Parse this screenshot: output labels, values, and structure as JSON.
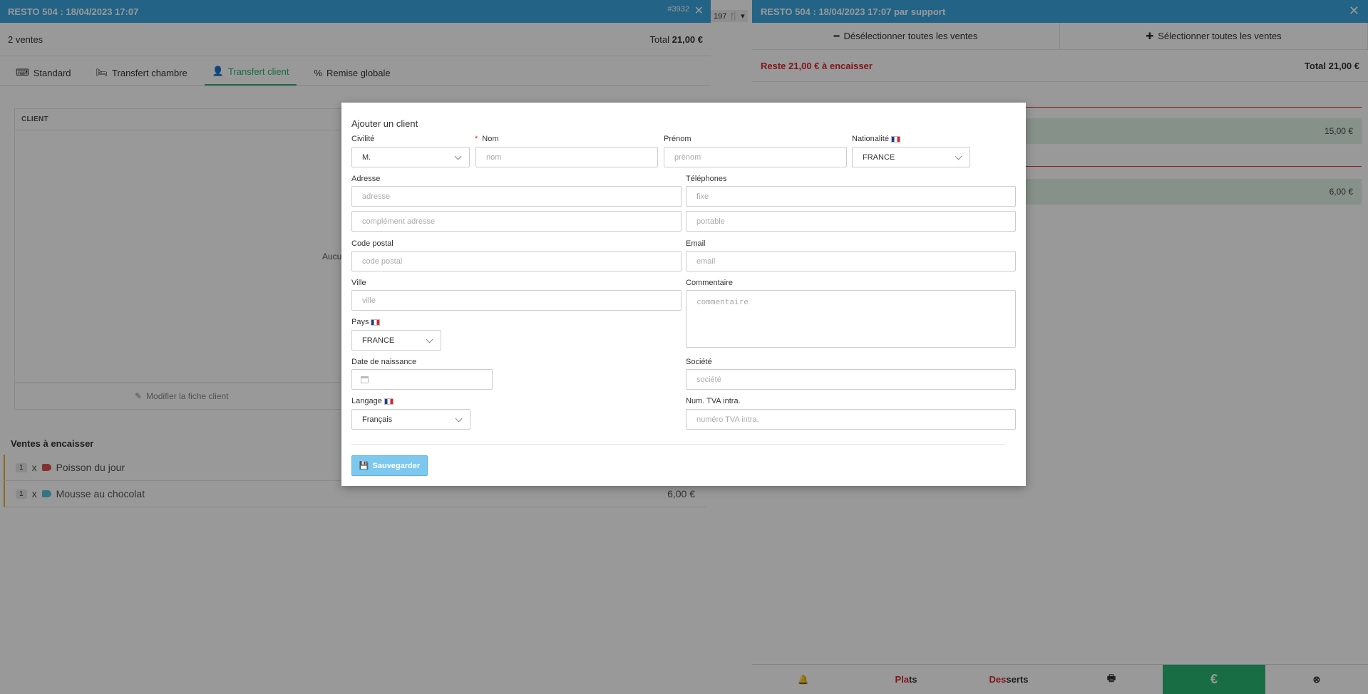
{
  "left": {
    "header_title": "RESTO 504 : 18/04/2023 17:07",
    "header_number": "#3932",
    "sales_count": "2 ventes",
    "total_label": "Total",
    "total_value": "21,00 €",
    "tabs": [
      {
        "label": "Standard",
        "icon": "keyboard-icon"
      },
      {
        "label": "Transfert chambre",
        "icon": "bed-icon"
      },
      {
        "label": "Transfert client",
        "icon": "user-icon",
        "active": true
      },
      {
        "label": "Remise globale",
        "icon": "percent-icon"
      }
    ],
    "client_header": "CLIENT",
    "client_empty_text": "Aucu",
    "edit_client_label": "Modifier la fiche client",
    "sales_title": "Ventes à encaisser",
    "sales": [
      {
        "qty": "1",
        "x": "x",
        "name": "Poisson du jour",
        "tag_color": "#d9534f",
        "price": ""
      },
      {
        "qty": "1",
        "x": "x",
        "name": "Mousse au chocolat",
        "tag_color": "#5bc0de",
        "price": "6,00 €"
      }
    ]
  },
  "mid": {
    "fragment": "197"
  },
  "right": {
    "header_title": "RESTO 504 : 18/04/2023 17:07 par support",
    "deselect_label": "Désélectionner toutes les ventes",
    "select_label": "Sélectionner toutes les ventes",
    "reste_label": "Reste 21,00 € à encaisser",
    "total_label": "Total 21,00 €",
    "row_values": [
      "15,00 €",
      "6,00 €"
    ],
    "bottom": {
      "plats_hl": "Pla",
      "plats_rest": "ts",
      "desserts_hl": "Des",
      "desserts_rest": "serts",
      "pay_symbol": "€"
    }
  },
  "modal": {
    "title": "Ajouter un client",
    "civilite": {
      "label": "Civilité",
      "value": "M."
    },
    "nom": {
      "label": "Nom",
      "placeholder": "nom"
    },
    "prenom": {
      "label": "Prénom",
      "placeholder": "prénom"
    },
    "nationalite": {
      "label": "Nationalité",
      "value": "FRANCE"
    },
    "adresse": {
      "label": "Adresse",
      "placeholder": "adresse",
      "placeholder2": "complément adresse"
    },
    "telephones": {
      "label": "Téléphones",
      "placeholder_fixe": "fixe",
      "placeholder_portable": "portable"
    },
    "code_postal": {
      "label": "Code postal",
      "placeholder": "code postal"
    },
    "email": {
      "label": "Email",
      "placeholder": "email"
    },
    "ville": {
      "label": "Ville",
      "placeholder": "ville"
    },
    "commentaire": {
      "label": "Commentaire",
      "placeholder": "commentaire"
    },
    "pays": {
      "label": "Pays",
      "value": "FRANCE"
    },
    "date_naissance": {
      "label": "Date de naissance"
    },
    "societe": {
      "label": "Société",
      "placeholder": "société"
    },
    "langage": {
      "label": "Langage",
      "value": "Français"
    },
    "tva": {
      "label": "Num. TVA intra.",
      "placeholder": "numéro TVA intra."
    },
    "save_label": "Sauvegarder"
  }
}
